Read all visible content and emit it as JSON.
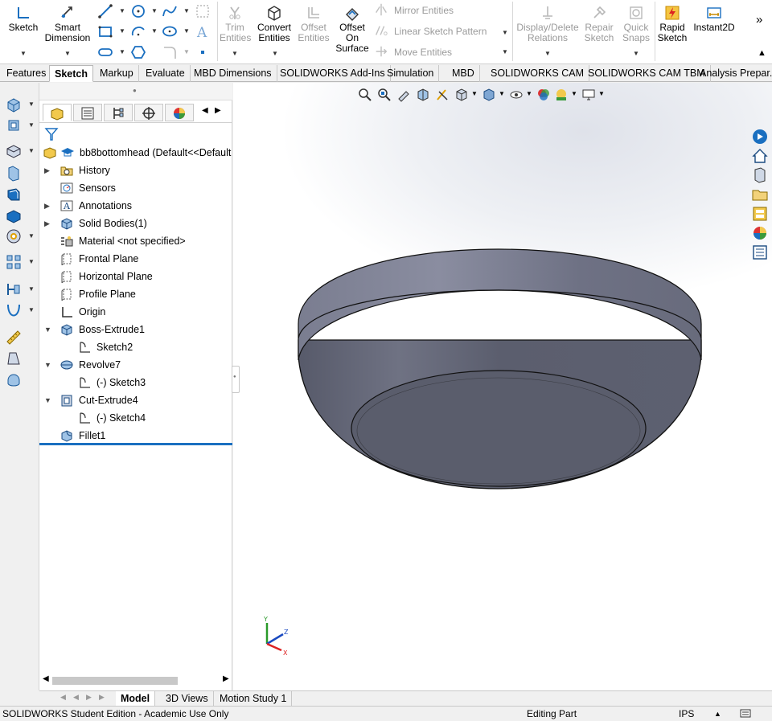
{
  "ribbon": {
    "sketch": "Sketch",
    "smart_dimension_1": "Smart",
    "smart_dimension_2": "Dimension",
    "trim_1": "Trim",
    "trim_2": "Entities",
    "convert_1": "Convert",
    "convert_2": "Entities",
    "offset_1": "Offset",
    "offset_2": "Entities",
    "offset_surface_1": "Offset",
    "offset_surface_2": "On",
    "offset_surface_3": "Surface",
    "mirror": "Mirror Entities",
    "linear_pattern": "Linear Sketch Pattern",
    "move": "Move Entities",
    "display_delete_1": "Display/Delete",
    "display_delete_2": "Relations",
    "repair_1": "Repair",
    "repair_2": "Sketch",
    "quick_snaps_1": "Quick",
    "quick_snaps_2": "Snaps",
    "rapid_1": "Rapid",
    "rapid_2": "Sketch",
    "instant2d": "Instant2D",
    "overflow": "»"
  },
  "tabs": [
    "Features",
    "Sketch",
    "Markup",
    "Evaluate",
    "MBD Dimensions",
    "SOLIDWORKS Add-Ins",
    "Simulation",
    "MBD",
    "SOLIDWORKS CAM",
    "SOLIDWORKS CAM TBM",
    "Analysis Prepar..."
  ],
  "active_tab": "Sketch",
  "tree": {
    "root": "bb8bottomhead  (Default<<Default",
    "items": [
      {
        "label": "History",
        "icon": "history-folder-icon",
        "arrow": "▶"
      },
      {
        "label": "Sensors",
        "icon": "sensors-icon",
        "arrow": ""
      },
      {
        "label": "Annotations",
        "icon": "annotations-icon",
        "arrow": "▶"
      },
      {
        "label": "Solid Bodies(1)",
        "icon": "solid-bodies-icon",
        "arrow": "▶"
      },
      {
        "label": "Material <not specified>",
        "icon": "material-icon",
        "arrow": ""
      },
      {
        "label": "Frontal Plane",
        "icon": "plane-icon",
        "arrow": ""
      },
      {
        "label": "Horizontal Plane",
        "icon": "plane-icon",
        "arrow": ""
      },
      {
        "label": "Profile Plane",
        "icon": "plane-icon",
        "arrow": ""
      },
      {
        "label": "Origin",
        "icon": "origin-icon",
        "arrow": ""
      },
      {
        "label": "Boss-Extrude1",
        "icon": "boss-extrude-icon",
        "arrow": "▼"
      },
      {
        "label": "Sketch2",
        "icon": "sketch-icon",
        "arrow": "",
        "child": true
      },
      {
        "label": "Revolve7",
        "icon": "revolve-icon",
        "arrow": "▼"
      },
      {
        "label": "(-) Sketch3",
        "icon": "sketch-icon",
        "arrow": "",
        "child": true
      },
      {
        "label": "Cut-Extrude4",
        "icon": "cut-extrude-icon",
        "arrow": "▼"
      },
      {
        "label": "(-) Sketch4",
        "icon": "sketch-icon",
        "arrow": "",
        "child": true
      },
      {
        "label": "Fillet1",
        "icon": "fillet-icon",
        "arrow": ""
      }
    ]
  },
  "bottom_tabs": [
    "Model",
    "3D Views",
    "Motion Study 1"
  ],
  "active_bottom_tab": "Model",
  "status": {
    "edition": "SOLIDWORKS Student Edition - Academic Use Only",
    "mode": "Editing Part",
    "units": "IPS",
    "units_caret": "▲"
  },
  "triad": {
    "x": "X",
    "y": "Y",
    "z": "Z"
  },
  "colors": {
    "accent": "#1a6fc0",
    "part_body": "#5c5f6e",
    "part_top": "#737687"
  }
}
